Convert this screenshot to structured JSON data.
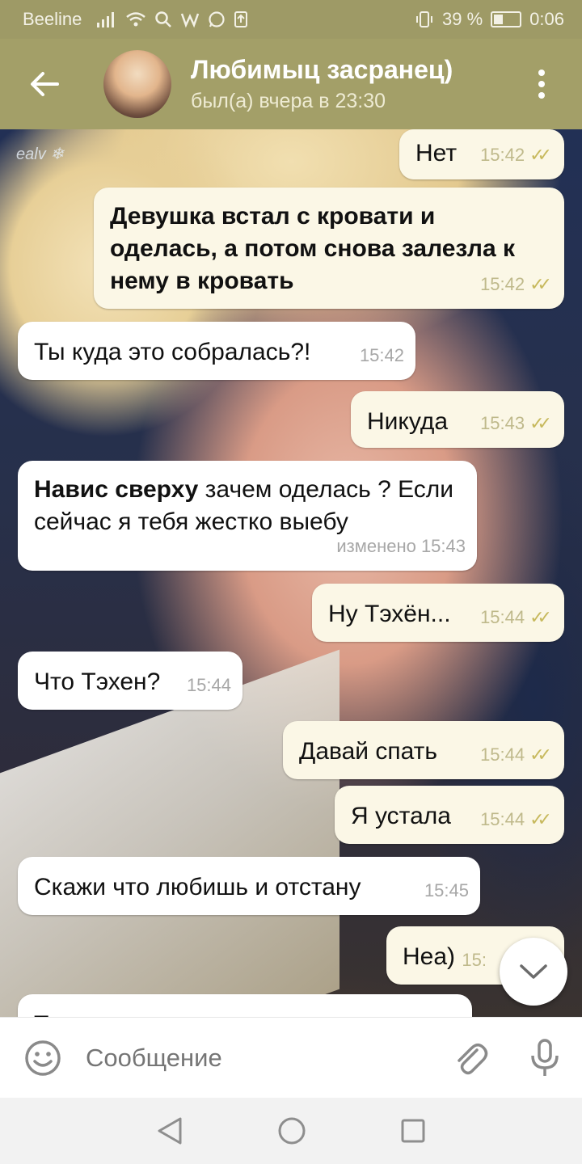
{
  "status_bar": {
    "carrier": "Beeline",
    "battery": "39 %",
    "time": "0:06"
  },
  "header": {
    "title": "Любимыц засранец)",
    "subtitle": "был(а) вчера в 23:30"
  },
  "wallpaper_signature": "ealv ❄",
  "messages": [
    {
      "dir": "out",
      "text": "Нет",
      "time": "15:42"
    },
    {
      "dir": "out",
      "text": "Девушка встал с кровати и оделась, а потом снова залезла к нему в кровать",
      "time": "15:42"
    },
    {
      "dir": "in",
      "text": "Ты куда это собралась?!",
      "time": "15:42"
    },
    {
      "dir": "out",
      "text": "Никуда",
      "time": "15:43"
    },
    {
      "dir": "in",
      "bold": "Навис сверху",
      "text": " зачем оделась ? Если сейчас я тебя жестко выебу",
      "time": "изменено 15:43"
    },
    {
      "dir": "out",
      "text": "Ну Тэхён...",
      "time": "15:44"
    },
    {
      "dir": "in",
      "text": "Что Тэхен?",
      "time": "15:44"
    },
    {
      "dir": "out",
      "text": "Давай спать",
      "time": "15:44"
    },
    {
      "dir": "out",
      "text": "Я устала",
      "time": "15:44"
    },
    {
      "dir": "in",
      "text": "Скажи что любишь и отстану",
      "time": "15:45"
    },
    {
      "dir": "out",
      "text": "Неа)",
      "time": "15:"
    },
    {
      "dir": "in",
      "text": "Т",
      "time": ""
    }
  ],
  "composer": {
    "placeholder": "Сообщение"
  },
  "icons": {
    "back": "arrow-left-icon",
    "menu": "more-vertical-icon",
    "emoji": "smile-icon",
    "attach": "paperclip-icon",
    "mic": "microphone-icon",
    "scroll": "chevron-down-icon"
  },
  "colors": {
    "header": "#a39f68",
    "status_bar": "#9e9a66",
    "outgoing_bubble": "#fbf7e6",
    "incoming_bubble": "#ffffff",
    "read_ticks": "#c7b95d"
  }
}
